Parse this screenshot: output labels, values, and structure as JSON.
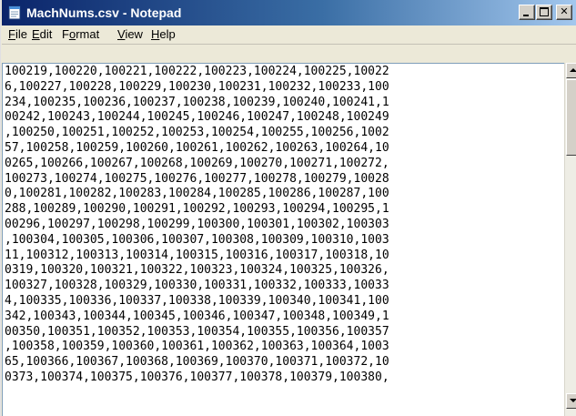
{
  "window": {
    "title": "MachNums.csv - Notepad",
    "caption_buttons": [
      "minimize",
      "maximize",
      "close"
    ]
  },
  "menu": {
    "items": [
      {
        "pre": "",
        "u": "F",
        "post": "ile"
      },
      {
        "pre": "",
        "u": "E",
        "post": "dit"
      },
      {
        "pre": "F",
        "u": "o",
        "post": "rmat"
      },
      {
        "pre": "",
        "u": "V",
        "post": "iew"
      },
      {
        "pre": "",
        "u": "H",
        "post": "elp"
      }
    ]
  },
  "editor": {
    "text": "100219,100220,100221,100222,100223,100224,100225,10022\n6,100227,100228,100229,100230,100231,100232,100233,100\n234,100235,100236,100237,100238,100239,100240,100241,1\n00242,100243,100244,100245,100246,100247,100248,100249\n,100250,100251,100252,100253,100254,100255,100256,1002\n57,100258,100259,100260,100261,100262,100263,100264,10\n0265,100266,100267,100268,100269,100270,100271,100272,\n100273,100274,100275,100276,100277,100278,100279,10028\n0,100281,100282,100283,100284,100285,100286,100287,100\n288,100289,100290,100291,100292,100293,100294,100295,1\n00296,100297,100298,100299,100300,100301,100302,100303\n,100304,100305,100306,100307,100308,100309,100310,1003\n11,100312,100313,100314,100315,100316,100317,100318,10\n0319,100320,100321,100322,100323,100324,100325,100326,\n100327,100328,100329,100330,100331,100332,100333,10033\n4,100335,100336,100337,100338,100339,100340,100341,100\n342,100343,100344,100345,100346,100347,100348,100349,1\n00350,100351,100352,100353,100354,100355,100356,100357\n,100358,100359,100360,100361,100362,100363,100364,1003\n65,100366,100367,100368,100369,100370,100371,100372,10\n0373,100374,100375,100376,100377,100378,100379,100380,"
  },
  "icons": {
    "app": "notepad-icon",
    "scroll_up": "arrow-up-icon",
    "scroll_down": "arrow-down-icon"
  },
  "colors": {
    "titlebar_start": "#0a246a",
    "titlebar_end": "#a6caf0",
    "title_text": "#ffffff",
    "chrome": "#ece9d8",
    "editor_bg": "#ffffff"
  }
}
